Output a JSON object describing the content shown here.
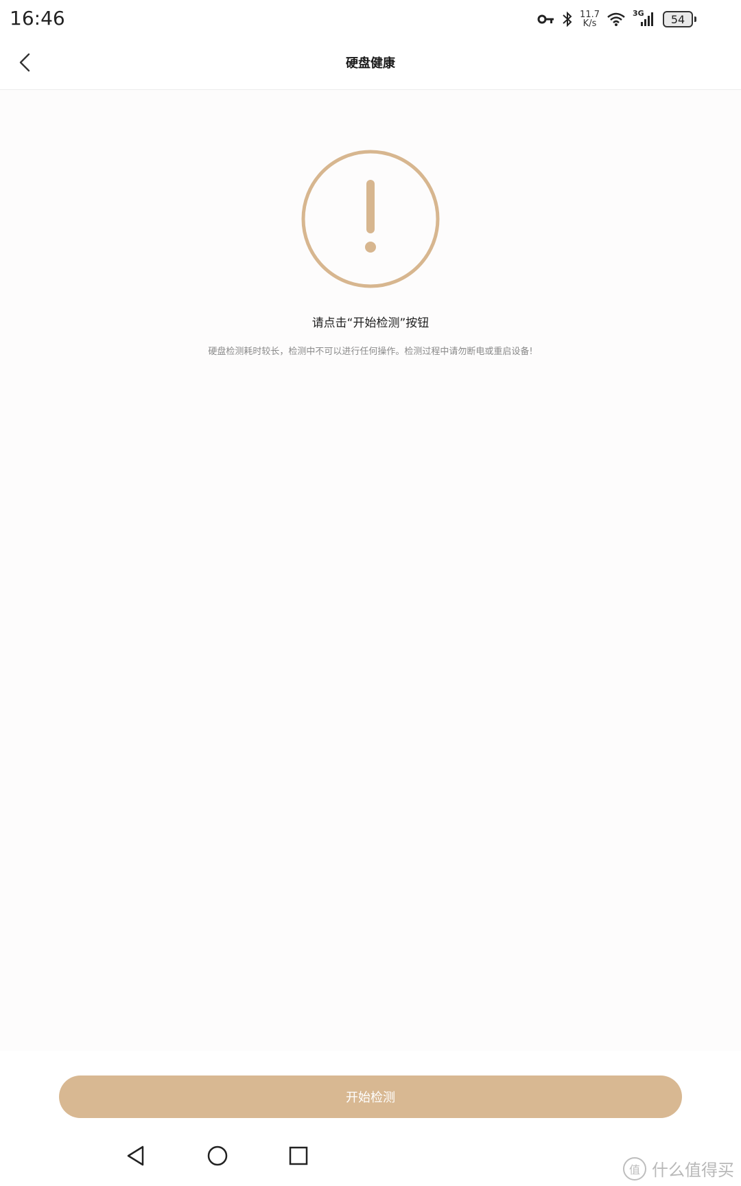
{
  "status_bar": {
    "time": "16:46",
    "net_speed_value": "11.7",
    "net_speed_unit": "K/s",
    "cellular_label": "3G",
    "battery_level": "54",
    "icons": [
      "vpn-key-icon",
      "bluetooth-icon",
      "wifi-icon",
      "cellular-signal-icon",
      "battery-icon"
    ]
  },
  "header": {
    "title": "硬盘健康",
    "back_icon": "chevron-left-icon"
  },
  "main": {
    "status_icon": "exclamation-circle-icon",
    "prompt": "请点击“开始检测”按钮",
    "hint": "硬盘检测耗时较长，检测中不可以进行任何操作。检测过程中请勿断电或重启设备!"
  },
  "actions": {
    "start_label": "开始检测"
  },
  "nav_bar": {
    "icons": [
      "nav-back-icon",
      "nav-home-icon",
      "nav-recent-icon"
    ]
  },
  "watermark": {
    "logo": "值",
    "text": "什么值得买"
  },
  "colors": {
    "accent": "#d8b892",
    "icon_stroke": "#d7b68f",
    "background": "#fdfcfc"
  }
}
